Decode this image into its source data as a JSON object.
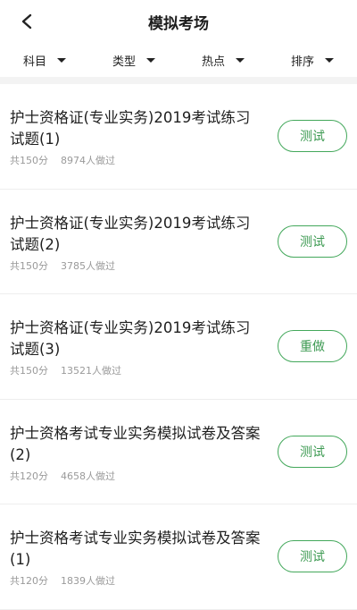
{
  "header": {
    "title": "模拟考场"
  },
  "filters": [
    {
      "label": "科目"
    },
    {
      "label": "类型"
    },
    {
      "label": "热点"
    },
    {
      "label": "排序"
    }
  ],
  "exams": [
    {
      "title": "护士资格证(专业实务)2019考试练习试题(1)",
      "score": "共150分",
      "count": "8974人做过",
      "action": "测试"
    },
    {
      "title": "护士资格证(专业实务)2019考试练习试题(2)",
      "score": "共150分",
      "count": "3785人做过",
      "action": "测试"
    },
    {
      "title": "护士资格证(专业实务)2019考试练习试题(3)",
      "score": "共150分",
      "count": "13521人做过",
      "action": "重做"
    },
    {
      "title": "护士资格考试专业实务模拟试卷及答案(2)",
      "score": "共120分",
      "count": "4658人做过",
      "action": "测试"
    },
    {
      "title": "护士资格考试专业实务模拟试卷及答案(1)",
      "score": "共120分",
      "count": "1839人做过",
      "action": "测试"
    }
  ]
}
